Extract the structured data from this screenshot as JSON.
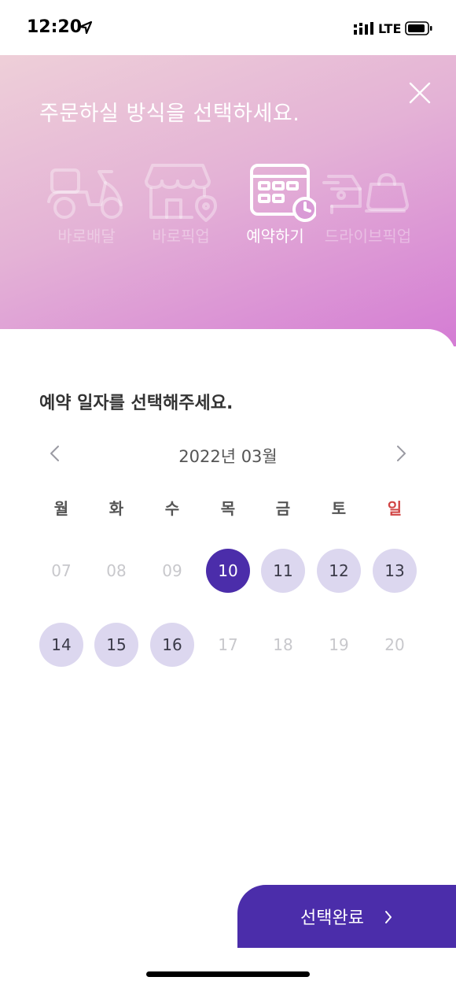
{
  "status_bar": {
    "time": "12:20",
    "network": "LTE"
  },
  "header": {
    "title": "주문하실 방식을 선택하세요.",
    "methods": [
      {
        "label": "바로배달",
        "icon": "scooter-icon",
        "active": false
      },
      {
        "label": "바로픽업",
        "icon": "store-icon",
        "active": false
      },
      {
        "label": "예약하기",
        "icon": "calendar-clock-icon",
        "active": true
      },
      {
        "label": "드라이브픽업",
        "icon": "car-bag-icon",
        "active": false
      }
    ]
  },
  "calendar": {
    "section_title": "예약 일자를 선택해주세요.",
    "month_label": "2022년 03월",
    "weekdays": [
      "월",
      "화",
      "수",
      "목",
      "금",
      "토",
      "일"
    ],
    "weeks": [
      [
        {
          "day": "07",
          "state": "disabled"
        },
        {
          "day": "08",
          "state": "disabled"
        },
        {
          "day": "09",
          "state": "disabled"
        },
        {
          "day": "10",
          "state": "selected"
        },
        {
          "day": "11",
          "state": "available"
        },
        {
          "day": "12",
          "state": "available"
        },
        {
          "day": "13",
          "state": "available"
        }
      ],
      [
        {
          "day": "14",
          "state": "available"
        },
        {
          "day": "15",
          "state": "available"
        },
        {
          "day": "16",
          "state": "available"
        },
        {
          "day": "17",
          "state": "disabled"
        },
        {
          "day": "18",
          "state": "disabled"
        },
        {
          "day": "19",
          "state": "disabled"
        },
        {
          "day": "20",
          "state": "disabled"
        }
      ]
    ]
  },
  "cta": {
    "label": "선택완료"
  },
  "colors": {
    "accent": "#4b2daa",
    "available_day": "#dcd7ef",
    "sunday": "#d14545"
  }
}
